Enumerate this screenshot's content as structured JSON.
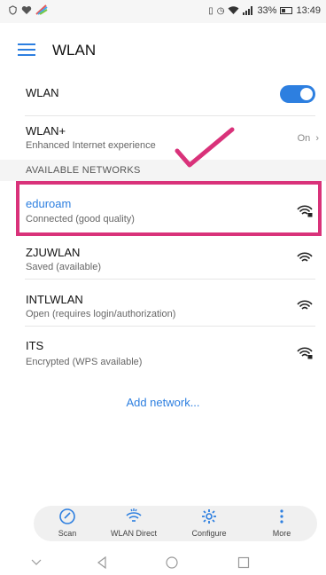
{
  "status_bar": {
    "right_text": "33%",
    "time": "13:49"
  },
  "app_bar": {
    "title": "WLAN"
  },
  "wlan_row": {
    "label": "WLAN",
    "enabled": true
  },
  "wlan_plus": {
    "title": "WLAN+",
    "subtitle": "Enhanced Internet experience",
    "value": "On"
  },
  "section_header": "AVAILABLE NETWORKS",
  "networks": [
    {
      "name": "eduroam",
      "status": "Connected (good quality)",
      "icon": "wifi-lock-icon"
    },
    {
      "name": "ZJUWLAN",
      "status": "Saved (available)",
      "icon": "wifi-icon"
    },
    {
      "name": "INTLWLAN",
      "status": "Open (requires login/authorization)",
      "icon": "wifi-icon"
    },
    {
      "name": "ITS",
      "status": "Encrypted (WPS available)",
      "icon": "wifi-lock-icon"
    }
  ],
  "add_network": "Add network...",
  "bottom_actions": [
    {
      "label": "Scan",
      "icon": "scan-icon"
    },
    {
      "label": "WLAN Direct",
      "icon": "wlan-direct-icon"
    },
    {
      "label": "Configure",
      "icon": "gear-icon"
    },
    {
      "label": "More",
      "icon": "more-vertical-icon"
    }
  ],
  "colors": {
    "accent": "#2d7fe0",
    "highlight": "#d9327a"
  }
}
